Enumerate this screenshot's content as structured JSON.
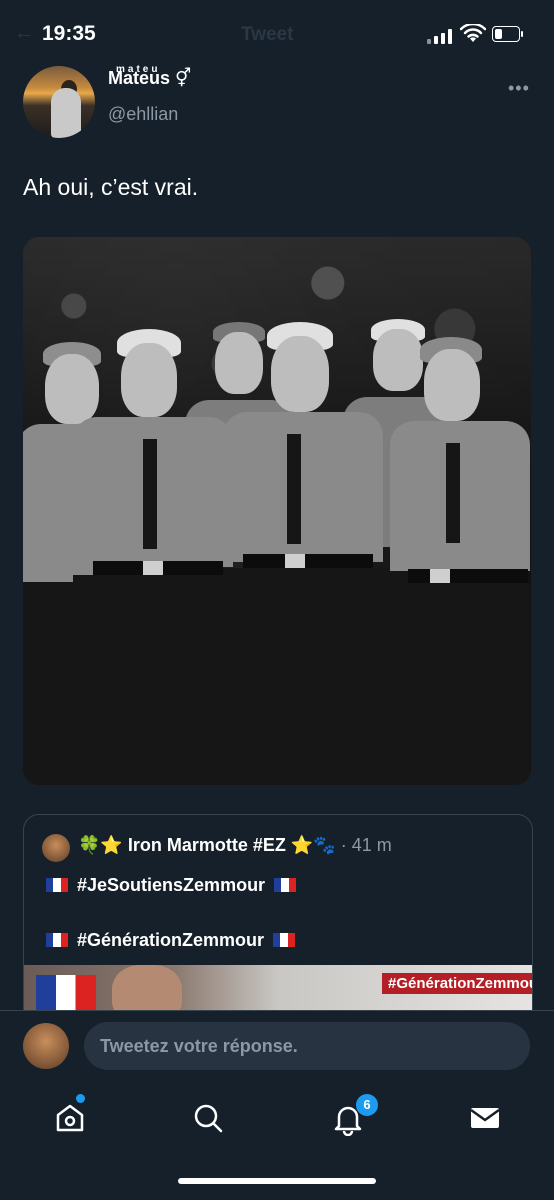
{
  "status_bar": {
    "time": "19:35",
    "ghost_title": "Tweet"
  },
  "tweet": {
    "display_name": "Mateus",
    "name_suffix": "⚥",
    "name_sup": "mateu",
    "handle": "@ehllian",
    "more": "•••",
    "text": "Ah oui, c’est vrai."
  },
  "quoted": {
    "emoji_prefix": "🍀⭐",
    "author": "Iron Marmotte #EZ",
    "emoji_suffix": "⭐🐾",
    "time": "· 41 m",
    "hashtag1": "#JeSoutiensZemmour",
    "hashtag2": "#GénérationZemmour",
    "image_banner": "#GénérationZemmour"
  },
  "reply": {
    "placeholder": "Tweetez votre réponse."
  },
  "tabbar": {
    "items": [
      "home-icon",
      "search-icon",
      "bell-icon",
      "mail-icon"
    ],
    "notifications_count": "6"
  },
  "colors": {
    "background": "#15202b",
    "accent": "#1d9bf0",
    "muted": "#8b98a5",
    "border": "#38444d"
  }
}
